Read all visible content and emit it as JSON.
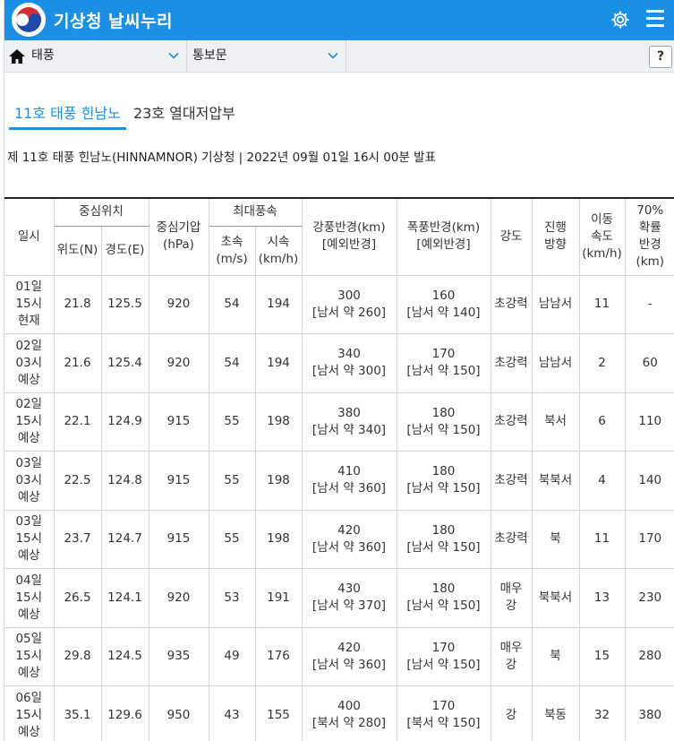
{
  "app": {
    "title": "기상청 날씨누리"
  },
  "icons": {
    "logo": "taegeuk-logo-icon",
    "settings": "gear-icon",
    "menu": "hamburger-menu-icon",
    "home": "home-icon",
    "dropdown": "chevron-down-icon"
  },
  "colors": {
    "accent": "#1a8fe3",
    "logo_red": "#d72c32",
    "logo_blue": "#1f4aa8"
  },
  "nav": {
    "dropdown1": "태풍",
    "dropdown2": "통보문",
    "help": "?"
  },
  "tabs": [
    {
      "label": "11호 태풍 힌남노",
      "active": true
    },
    {
      "label": "23호 열대저압부",
      "active": false
    }
  ],
  "issue_line": "제 11호 태풍 힌남노(HINNAMNOR) 기상청 | 2022년 09월 01일 16시 00분 발표",
  "table": {
    "headers": {
      "date": "일시",
      "center": "중심위치",
      "lat": "위도(N)",
      "lon": "경도(E)",
      "pressure": "중심기압\n(hPa)",
      "maxwind": "최대풍속",
      "ms": "초속\n(m/s)",
      "kmh": "시속\n(km/h)",
      "gale": "강풍반경(km)\n[예외반경]",
      "storm": "폭풍반경(km)\n[예외반경]",
      "intensity": "강도",
      "direction": "진행\n방향",
      "speed": "이동\n속도\n(km/h)",
      "prob": "70%\n확률\n반경\n(km)"
    },
    "rows": [
      {
        "date": "01일\n15시\n현재",
        "lat": "21.8",
        "lon": "125.5",
        "pressure": "920",
        "ms": "54",
        "kmh": "194",
        "gale": "300\n[남서 약 260]",
        "storm": "160\n[남서 약 140]",
        "intensity": "초강력",
        "direction": "남남서",
        "speed": "11",
        "prob": "-"
      },
      {
        "date": "02일\n03시\n예상",
        "lat": "21.6",
        "lon": "125.4",
        "pressure": "920",
        "ms": "54",
        "kmh": "194",
        "gale": "340\n[남서 약 300]",
        "storm": "170\n[남서 약 150]",
        "intensity": "초강력",
        "direction": "남남서",
        "speed": "2",
        "prob": "60"
      },
      {
        "date": "02일\n15시\n예상",
        "lat": "22.1",
        "lon": "124.9",
        "pressure": "915",
        "ms": "55",
        "kmh": "198",
        "gale": "380\n[남서 약 340]",
        "storm": "180\n[남서 약 150]",
        "intensity": "초강력",
        "direction": "북서",
        "speed": "6",
        "prob": "110"
      },
      {
        "date": "03일\n03시\n예상",
        "lat": "22.5",
        "lon": "124.8",
        "pressure": "915",
        "ms": "55",
        "kmh": "198",
        "gale": "410\n[남서 약 360]",
        "storm": "180\n[남서 약 150]",
        "intensity": "초강력",
        "direction": "북북서",
        "speed": "4",
        "prob": "140"
      },
      {
        "date": "03일\n15시\n예상",
        "lat": "23.7",
        "lon": "124.7",
        "pressure": "915",
        "ms": "55",
        "kmh": "198",
        "gale": "420\n[남서 약 360]",
        "storm": "180\n[남서 약 150]",
        "intensity": "초강력",
        "direction": "북",
        "speed": "11",
        "prob": "170"
      },
      {
        "date": "04일\n15시\n예상",
        "lat": "26.5",
        "lon": "124.1",
        "pressure": "920",
        "ms": "53",
        "kmh": "191",
        "gale": "430\n[남서 약 370]",
        "storm": "180\n[남서 약 150]",
        "intensity": "매우\n강",
        "direction": "북북서",
        "speed": "13",
        "prob": "230"
      },
      {
        "date": "05일\n15시\n예상",
        "lat": "29.8",
        "lon": "124.5",
        "pressure": "935",
        "ms": "49",
        "kmh": "176",
        "gale": "420\n[남서 약 360]",
        "storm": "170\n[남서 약 150]",
        "intensity": "매우\n강",
        "direction": "북",
        "speed": "15",
        "prob": "280"
      },
      {
        "date": "06일\n15시\n예상",
        "lat": "35.1",
        "lon": "129.6",
        "pressure": "950",
        "ms": "43",
        "kmh": "155",
        "gale": "400\n[북서 약 280]",
        "storm": "170\n[북서 약 150]",
        "intensity": "강",
        "direction": "북동",
        "speed": "32",
        "prob": "380"
      }
    ]
  }
}
